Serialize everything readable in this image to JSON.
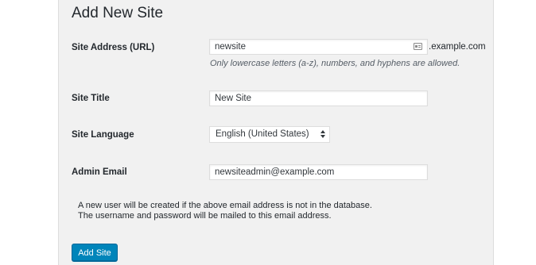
{
  "form": {
    "title": "Add New Site",
    "site_address": {
      "label": "Site Address (URL)",
      "value": "newsite",
      "icon": "contact-card-icon",
      "domain_suffix": ".example.com",
      "hint": "Only lowercase letters (a-z), numbers, and hyphens are allowed."
    },
    "site_title": {
      "label": "Site Title",
      "value": "New Site"
    },
    "site_language": {
      "label": "Site Language",
      "selected": "English (United States)"
    },
    "admin_email": {
      "label": "Admin Email",
      "value": "newsiteadmin@example.com"
    },
    "note": {
      "line1": "A new user will be created if the above email address is not in the database.",
      "line2": "The username and password will be mailed to this email address."
    },
    "submit_label": "Add Site"
  },
  "colors": {
    "panel_background": "#f1f1f1",
    "primary_button": "#0085ba",
    "text": "#23282d",
    "hint_text": "#555d66"
  }
}
